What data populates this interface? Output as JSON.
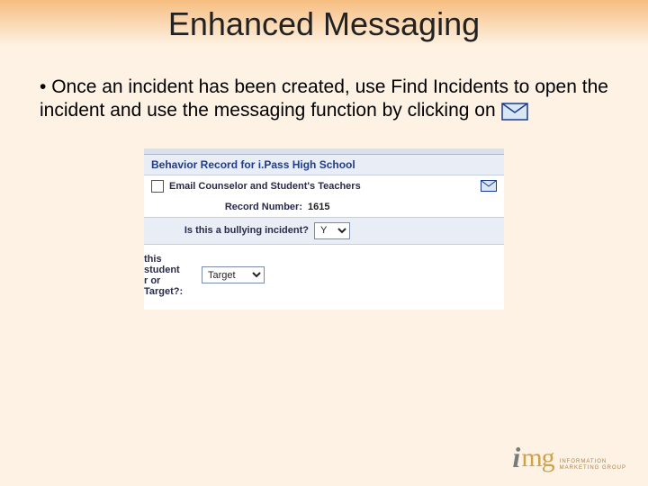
{
  "title": "Enhanced Messaging",
  "bullet_text": "Once an incident has been created, use Find Incidents to open the incident and use the messaging function by clicking on",
  "inline_icon": "mail-icon",
  "screenshot": {
    "header": "Behavior Record for i.Pass High School",
    "email_row": {
      "checkbox_checked": false,
      "label": "Email Counselor and Student's Teachers"
    },
    "record_label": "Record Number:",
    "record_value": "1615",
    "bully_label": "Is this a bullying incident?",
    "bully_value": "Y",
    "role_label_line1": "this student",
    "role_label_line2": "r or Target?:",
    "role_value": "Target"
  },
  "logo": {
    "i": "i",
    "mg": "mg",
    "line1": "INFORMATION",
    "line2": "MARKETING GROUP"
  }
}
